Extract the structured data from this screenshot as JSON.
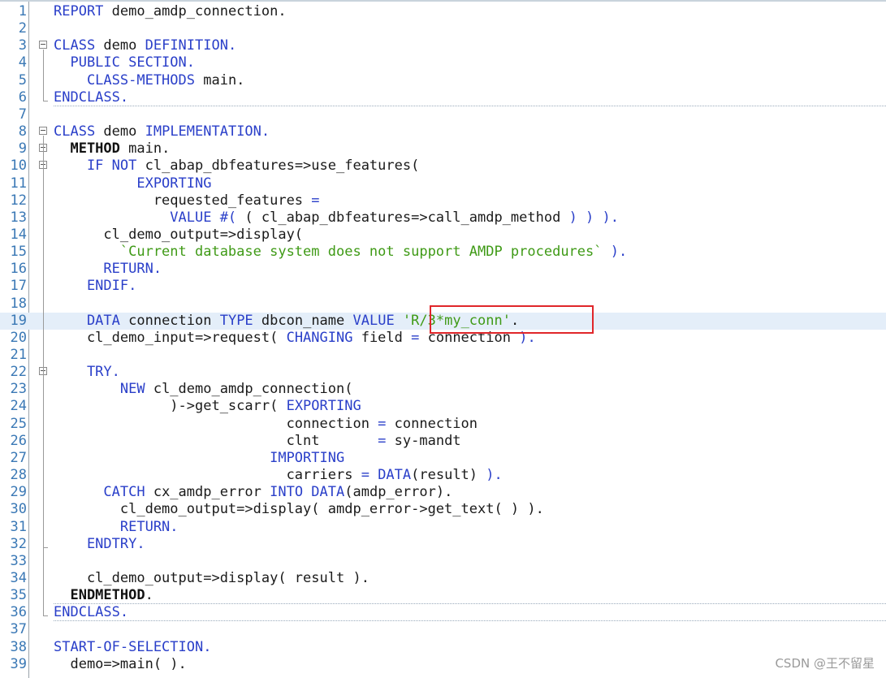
{
  "lines": [
    [
      [
        "kw",
        "REPORT"
      ],
      [
        "id",
        " demo_amdp_connection."
      ]
    ],
    [],
    [
      [
        "kw",
        "CLASS"
      ],
      [
        "id",
        " demo "
      ],
      [
        "kw",
        "DEFINITION."
      ]
    ],
    [
      [
        "kw",
        "  PUBLIC SECTION."
      ]
    ],
    [
      [
        "kw",
        "    CLASS-METHODS"
      ],
      [
        "id",
        " main."
      ]
    ],
    [
      [
        "kw",
        "ENDCLASS."
      ]
    ],
    [],
    [
      [
        "kw",
        "CLASS"
      ],
      [
        "id",
        " demo "
      ],
      [
        "kw",
        "IMPLEMENTATION."
      ]
    ],
    [
      [
        "kb",
        "  METHOD"
      ],
      [
        "id",
        " main."
      ]
    ],
    [
      [
        "kw",
        "    IF NOT"
      ],
      [
        "id",
        " cl_abap_dbfeatures=>use_features("
      ]
    ],
    [
      [
        "kw",
        "          EXPORTING"
      ]
    ],
    [
      [
        "id",
        "            requested_features "
      ],
      [
        "kw",
        "="
      ]
    ],
    [
      [
        "kw",
        "              VALUE #( "
      ],
      [
        "id",
        "( cl_abap_dbfeatures=>call_amdp_method "
      ],
      [
        "kw",
        ") ) )."
      ]
    ],
    [
      [
        "id",
        "      cl_demo_output=>display("
      ]
    ],
    [
      [
        "str",
        "        `Current database system does not support AMDP procedures` "
      ],
      [
        "kw",
        ")."
      ]
    ],
    [
      [
        "kw",
        "      RETURN."
      ]
    ],
    [
      [
        "kw",
        "    ENDIF."
      ]
    ],
    [],
    [
      [
        "kw",
        "    DATA"
      ],
      [
        "id",
        " connection "
      ],
      [
        "kw",
        "TYPE"
      ],
      [
        "id",
        " dbcon_name "
      ],
      [
        "kw",
        "VALUE "
      ],
      [
        "str",
        "'R/3*my_conn'"
      ],
      [
        "id",
        "."
      ]
    ],
    [
      [
        "id",
        "    cl_demo_input=>request( "
      ],
      [
        "kw",
        "CHANGING"
      ],
      [
        "id",
        " field "
      ],
      [
        "kw",
        "="
      ],
      [
        "id",
        " connection "
      ],
      [
        "kw",
        ")."
      ]
    ],
    [],
    [
      [
        "kw",
        "    TRY."
      ]
    ],
    [
      [
        "kw",
        "        NEW"
      ],
      [
        "id",
        " cl_demo_amdp_connection("
      ]
    ],
    [
      [
        "id",
        "              )->get_scarr( "
      ],
      [
        "kw",
        "EXPORTING"
      ]
    ],
    [
      [
        "id",
        "                            connection "
      ],
      [
        "kw",
        "="
      ],
      [
        "id",
        " connection"
      ]
    ],
    [
      [
        "id",
        "                            clnt       "
      ],
      [
        "kw",
        "="
      ],
      [
        "id",
        " sy-mandt"
      ]
    ],
    [
      [
        "kw",
        "                          IMPORTING"
      ]
    ],
    [
      [
        "id",
        "                            carriers "
      ],
      [
        "kw",
        "="
      ],
      [
        "kw",
        " DATA"
      ],
      [
        "id",
        "(result) "
      ],
      [
        "kw",
        ")."
      ]
    ],
    [
      [
        "kw",
        "      CATCH"
      ],
      [
        "id",
        " cx_amdp_error "
      ],
      [
        "kw",
        "INTO DATA"
      ],
      [
        "id",
        "(amdp_error)."
      ]
    ],
    [
      [
        "id",
        "        cl_demo_output=>display( amdp_error->get_text( ) )."
      ]
    ],
    [
      [
        "kw",
        "        RETURN."
      ]
    ],
    [
      [
        "kw",
        "    ENDTRY."
      ]
    ],
    [],
    [
      [
        "id",
        "    cl_demo_output=>display( result )."
      ]
    ],
    [
      [
        "kb",
        "  ENDMETHOD"
      ],
      [
        "id",
        "."
      ]
    ],
    [
      [
        "kw",
        "ENDCLASS."
      ]
    ],
    [],
    [
      [
        "kw",
        "START-OF-SELECTION."
      ]
    ],
    [
      [
        "id",
        "  demo=>main( )."
      ]
    ]
  ],
  "highlight_line": 19,
  "watermark": "CSDN @王不留星"
}
